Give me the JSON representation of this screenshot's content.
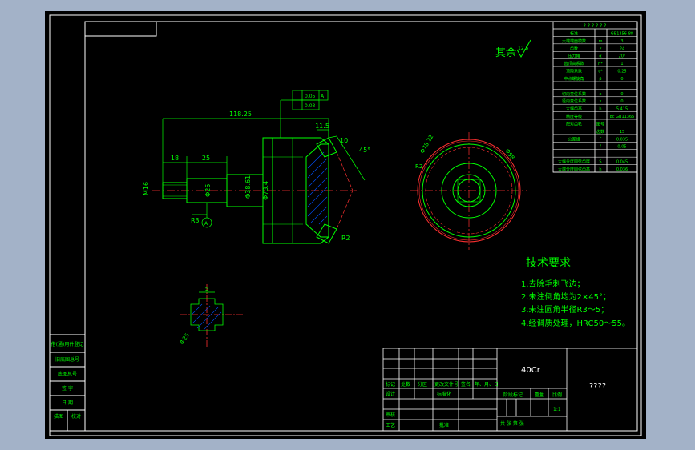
{
  "drawing": {
    "surface_roughness_note": "其余",
    "roughness_value": "12.5",
    "dims": {
      "len_118": "118.25",
      "len_18": "18",
      "len_25": "25",
      "len_11": "11.5",
      "len_10": "10",
      "ang_45": "45°",
      "m16": "M16",
      "d_shaft1": "Φ25",
      "d_shaft2": "Φ38.61",
      "d_74": "Φ73.4",
      "d_r2": "R2",
      "d_r3": "R3",
      "angle_a": "A",
      "tol_1": "0.05",
      "tol_1_ref": "A",
      "tol_2": "0.03",
      "cs_d": "Φ25",
      "cs_w": "5",
      "front_d1": "Φ78.22",
      "front_d2": "Φ58"
    },
    "tech_req": {
      "title": "技术要求",
      "items": [
        "1.去除毛刺飞边；",
        "2.未注倒角均为2×45°；",
        "3.未注圆角半径R3～5；",
        "4.经调质处理，HRC50～55。"
      ]
    },
    "param_table": {
      "header": "? ? ? ? ? ?",
      "rows": [
        {
          "c1": "标准",
          "c3": "GB1356-88"
        },
        {
          "c1": "大端端面模数",
          "c2": "m",
          "c3": "3"
        },
        {
          "c1": "齿数",
          "c2": "z",
          "c3": "24"
        },
        {
          "c1": "压力角",
          "c2": "α",
          "c3": "20°"
        },
        {
          "c1": "齿顶高系数",
          "c2": "h*",
          "c3": "1"
        },
        {
          "c1": "顶隙系数",
          "c2": "c*",
          "c3": "0.25"
        },
        {
          "c1": "中点螺旋角",
          "c2": "β",
          "c3": "0"
        },
        {
          "c1": "",
          "c2": "",
          "c3": ""
        },
        {
          "c1": "切向变位系数",
          "c2": "x",
          "c3": "0"
        },
        {
          "c1": "径向变位系数",
          "c2": "x",
          "c3": "0"
        },
        {
          "c1": "大端齿高",
          "c2": "h",
          "c3": "5.415"
        },
        {
          "c1": "精度等级",
          "c2": "",
          "c3": "8c GB11365"
        },
        {
          "c1": "配对齿轮",
          "c2": "图号",
          "c3": ""
        },
        {
          "c1": "",
          "c2": "齿数",
          "c3": "15"
        },
        {
          "c1": "公差组",
          "c2": "F",
          "c3": "0.035"
        },
        {
          "c1": "",
          "c2": "f",
          "c3": "0.05"
        },
        {
          "c1": "",
          "c2": "",
          "c3": ""
        },
        {
          "c1": "大端分度圆弦齿厚",
          "c2": "S",
          "c3": "0.045"
        },
        {
          "c1": "大端分度圆弦齿高",
          "c2": "h",
          "c3": "0.036"
        }
      ]
    },
    "left_strip": [
      "借(通)用件登记",
      "旧底图总号",
      "底图总号",
      "签 字",
      "日 期"
    ],
    "left_strip_bottom": [
      "描图",
      "校对"
    ],
    "title_block": {
      "material": "40Cr",
      "name": "????",
      "row_labels": [
        "标记",
        "处数",
        "分区",
        "更改文件号",
        "签名",
        "年、月、日"
      ],
      "design": "设计",
      "std": "标准化",
      "review": "审核",
      "process": "工艺",
      "approve": "批准",
      "stage": "阶段标记",
      "weight": "重量",
      "scale": "比例",
      "scale_val": "1:1",
      "sheets": "共    张    第    张"
    }
  },
  "colors": {
    "background": "#a3b2c8",
    "paper": "#000000",
    "line": "#ffffff",
    "geometry": "#00ff00",
    "dimension": "#00ff00",
    "red": "#ff3030",
    "cyan": "#00ffff",
    "hatch": "#0050ff",
    "text": "#ffffff"
  }
}
